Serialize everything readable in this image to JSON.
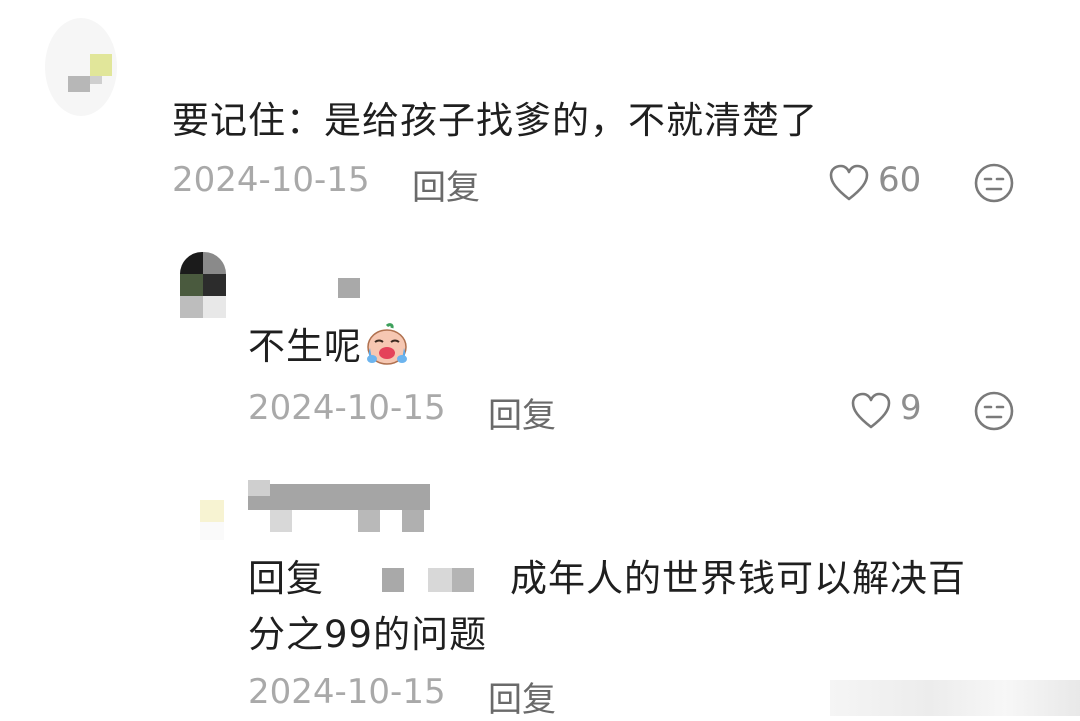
{
  "comment1": {
    "text": "要记住：是给孩子找爹的，不就清楚了",
    "date": "2024-10-15",
    "reply_label": "回复",
    "likes": "60"
  },
  "comment2": {
    "text": "不生呢",
    "date": "2024-10-15",
    "reply_label": "回复",
    "likes": "9"
  },
  "comment3": {
    "reply_prefix": "回复",
    "text_line1": "成年人的世界钱可以解决百",
    "text_line2": "分之99的问题",
    "date": "2024-10-15",
    "reply_label": "回复"
  },
  "icons": {
    "like": "heart-outline-icon",
    "dislike": "neutral-face-icon",
    "emoji": "crying-laughing-emoji"
  },
  "colors": {
    "text": "#1f1f1f",
    "meta": "#a9a9a9",
    "icon": "#7a7a7a"
  }
}
